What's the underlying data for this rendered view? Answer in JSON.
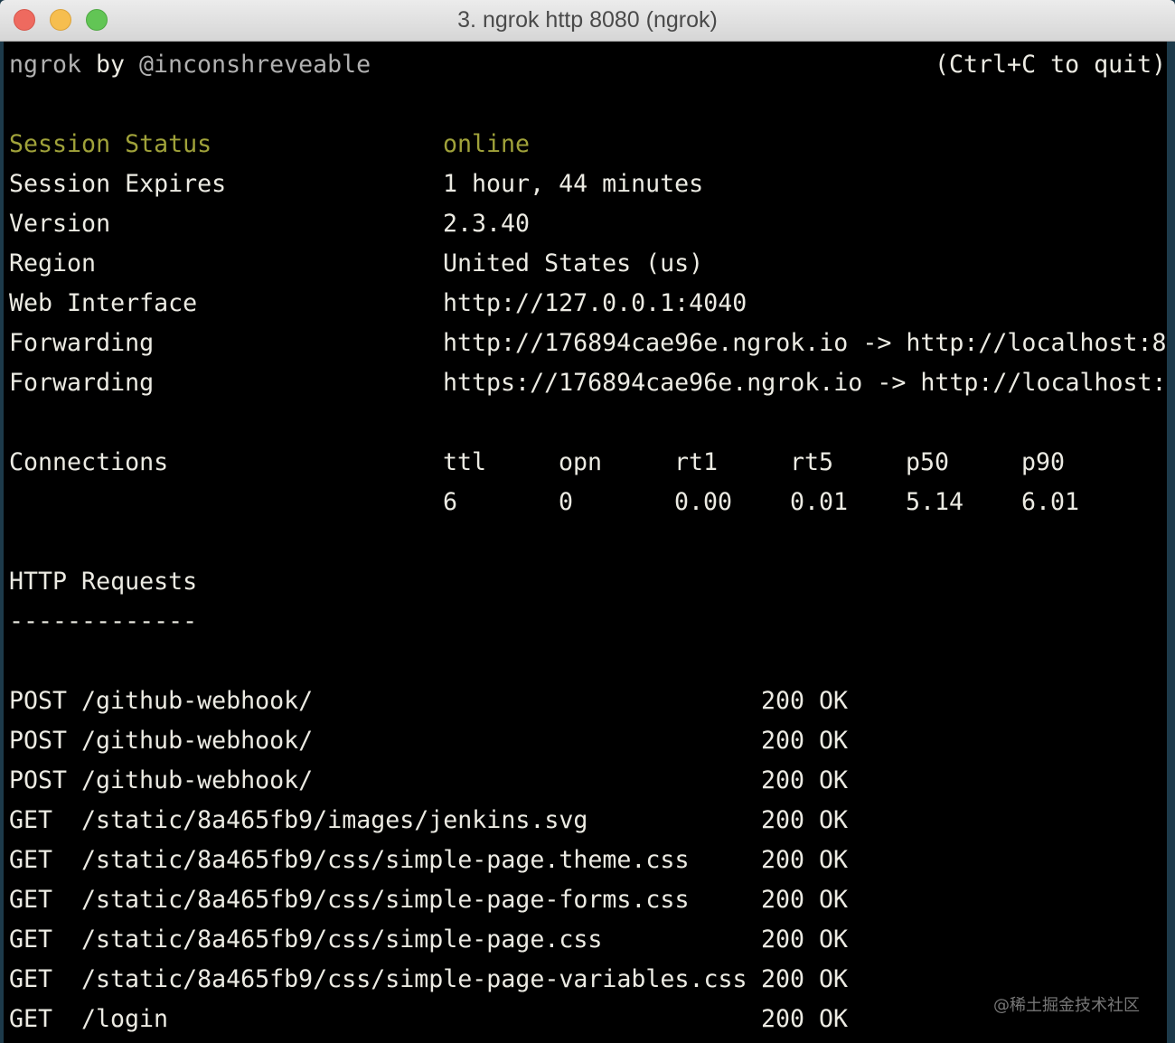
{
  "window": {
    "title": "3. ngrok http 8080 (ngrok)"
  },
  "header": {
    "brand": "ngrok",
    "by": "by",
    "author": "@inconshreveable",
    "quit_hint": "(Ctrl+C to quit)"
  },
  "status": {
    "session_status_label": "Session Status",
    "session_status": "online",
    "session_expires_label": "Session Expires",
    "session_expires": "1 hour, 44 minutes",
    "version_label": "Version",
    "version": "2.3.40",
    "region_label": "Region",
    "region": "United States (us)",
    "web_interface_label": "Web Interface",
    "web_interface": "http://127.0.0.1:4040",
    "forwarding": [
      {
        "label": "Forwarding",
        "value": "http://176894cae96e.ngrok.io -> http://localhost:8"
      },
      {
        "label": "Forwarding",
        "value": "https://176894cae96e.ngrok.io -> http://localhost:"
      }
    ]
  },
  "connections": {
    "label": "Connections",
    "headers": [
      "ttl",
      "opn",
      "rt1",
      "rt5",
      "p50",
      "p90"
    ],
    "values": [
      "6",
      "0",
      "0.00",
      "0.01",
      "5.14",
      "6.01"
    ]
  },
  "http_requests": {
    "title": "HTTP Requests",
    "rule": "-------------",
    "rows": [
      {
        "method": "POST",
        "path": "/github-webhook/",
        "code": "200",
        "status": "OK"
      },
      {
        "method": "POST",
        "path": "/github-webhook/",
        "code": "200",
        "status": "OK"
      },
      {
        "method": "POST",
        "path": "/github-webhook/",
        "code": "200",
        "status": "OK"
      },
      {
        "method": "GET",
        "path": "/static/8a465fb9/images/jenkins.svg",
        "code": "200",
        "status": "OK"
      },
      {
        "method": "GET",
        "path": "/static/8a465fb9/css/simple-page.theme.css",
        "code": "200",
        "status": "OK"
      },
      {
        "method": "GET",
        "path": "/static/8a465fb9/css/simple-page-forms.css",
        "code": "200",
        "status": "OK"
      },
      {
        "method": "GET",
        "path": "/static/8a465fb9/css/simple-page.css",
        "code": "200",
        "status": "OK"
      },
      {
        "method": "GET",
        "path": "/static/8a465fb9/css/simple-page-variables.css",
        "code": "200",
        "status": "OK"
      },
      {
        "method": "GET",
        "path": "/login",
        "code": "200",
        "status": "OK"
      }
    ]
  },
  "watermark": "@稀土掘金技术社区"
}
